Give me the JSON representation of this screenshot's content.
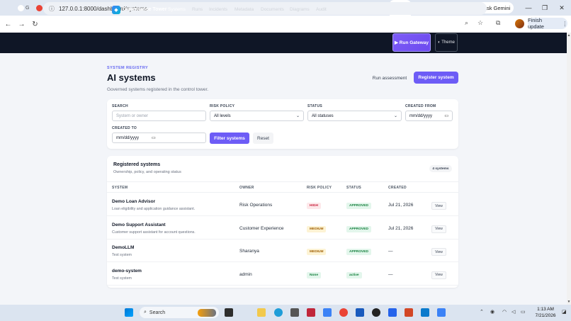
{
  "browser": {
    "tabs": [
      {
        "label": "G",
        "color": "#ffffff"
      },
      {
        "label": "M",
        "color": "#ea4335"
      },
      {
        "label": "",
        "color": "#5b5fc7"
      },
      {
        "label": "",
        "color": "#888888"
      },
      {
        "label": "",
        "color": "#888888"
      },
      {
        "label": "",
        "color": "#888888"
      },
      {
        "label": "",
        "color": "#888888"
      },
      {
        "label": "",
        "color": "#4285f4"
      },
      {
        "label": "",
        "color": "#4285f4"
      },
      {
        "label": "",
        "color": "#888888"
      },
      {
        "label": "",
        "color": "#222222"
      },
      {
        "label": "",
        "color": "#222222"
      },
      {
        "label": "",
        "color": "#222222"
      },
      {
        "label": "",
        "color": "#888888"
      },
      {
        "label": "",
        "color": "#4285f4"
      },
      {
        "label": "",
        "color": "#888888"
      },
      {
        "label": "",
        "color": "#222222"
      },
      {
        "label": "",
        "color": "#4285f4"
      },
      {
        "label": "",
        "color": "#10a37f"
      },
      {
        "label": "",
        "color": "#888888"
      },
      {
        "label": "",
        "color": "#888888"
      },
      {
        "label": "",
        "color": "#888888"
      }
    ],
    "active_tab_close": "✕",
    "new_tab": "+",
    "ask_gemini": "Ask Gemini",
    "url": "127.0.0.1:8000/dashboard/systems",
    "finish_update": "Finish update"
  },
  "app": {
    "brand": "Governance Tower",
    "nav": [
      "Systems",
      "Runs",
      "Incidents",
      "Metadata",
      "Documents",
      "Diagrams",
      "Audit"
    ],
    "run_gateway": "▶ Run Gateway",
    "theme": "◐ Theme"
  },
  "page": {
    "eyebrow": "SYSTEM REGISTRY",
    "title": "AI systems",
    "subtitle": "Governed systems registered in the control tower.",
    "run_assessment": "Run assessment",
    "register_system": "Register system"
  },
  "filters": {
    "search_label": "SEARCH",
    "search_placeholder": "System or owner",
    "risk_label": "RISK POLICY",
    "risk_value": "All levels",
    "status_label": "STATUS",
    "status_value": "All statuses",
    "created_from_label": "CREATED FROM",
    "created_from_value": "mm/dd/yyyy",
    "created_to_label": "CREATED TO",
    "created_to_value": "mm/dd/yyyy",
    "filter_button": "Filter systems",
    "reset_button": "Reset"
  },
  "table": {
    "title": "Registered systems",
    "subtitle": "Ownership, policy, and operating status",
    "count": "4 systems",
    "headers": [
      "SYSTEM",
      "OWNER",
      "RISK POLICY",
      "STATUS",
      "CREATED"
    ],
    "rows": [
      {
        "name": "Demo Loan Advisor",
        "desc": "Loan eligibility and application guidance assistant.",
        "owner": "Risk Operations",
        "risk": "HIGH",
        "status": "APPROVED",
        "created": "Jul 21, 2026",
        "action": "View"
      },
      {
        "name": "Demo Support Assistant",
        "desc": "Customer support assistant for account questions.",
        "owner": "Customer Experience",
        "risk": "MEDIUM",
        "status": "APPROVED",
        "created": "Jul 21, 2026",
        "action": "View"
      },
      {
        "name": "DemoLLM",
        "desc": "Test system",
        "owner": "Sharanya",
        "risk": "MEDIUM",
        "status": "APPROVED",
        "created": "—",
        "action": "View"
      },
      {
        "name": "demo-system",
        "desc": "Test system",
        "owner": "admin",
        "risk": "None",
        "status": "active",
        "created": "—",
        "action": "View"
      }
    ]
  },
  "colors": {
    "accent": "#6d5cf6",
    "header_bg": "#0f1626",
    "high_bg": "#fde8ea",
    "high_fg": "#c81e3a",
    "medium_bg": "#fdf3d4",
    "medium_fg": "#a16207",
    "approved_bg": "#e3f6ec",
    "approved_fg": "#15803d"
  },
  "taskbar": {
    "search": "Search",
    "time": "1:13 AM",
    "date": "7/21/2026"
  }
}
